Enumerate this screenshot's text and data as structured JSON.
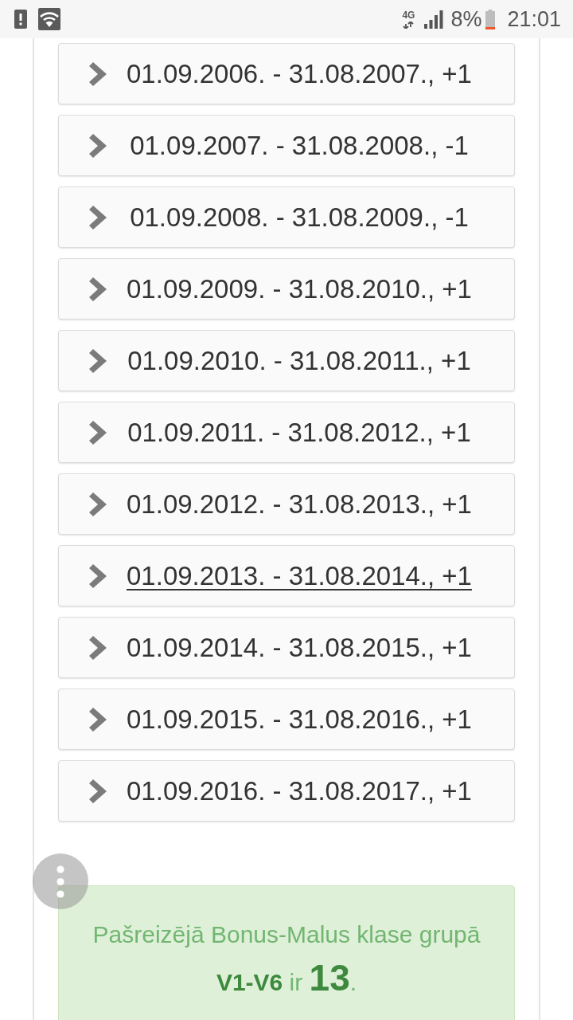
{
  "status_bar": {
    "network_type": "4G",
    "battery": "8%",
    "time": "21:01"
  },
  "periods": [
    {
      "label": "01.09.2006. - 31.08.2007., +1",
      "hovered": false
    },
    {
      "label": "01.09.2007. - 31.08.2008., -1",
      "hovered": false
    },
    {
      "label": "01.09.2008. - 31.08.2009., -1",
      "hovered": false
    },
    {
      "label": "01.09.2009. - 31.08.2010., +1",
      "hovered": false
    },
    {
      "label": "01.09.2010. - 31.08.2011., +1",
      "hovered": false
    },
    {
      "label": "01.09.2011. - 31.08.2012., +1",
      "hovered": false
    },
    {
      "label": "01.09.2012. - 31.08.2013., +1",
      "hovered": false
    },
    {
      "label": "01.09.2013. - 31.08.2014., +1",
      "hovered": true
    },
    {
      "label": "01.09.2014. - 31.08.2015., +1",
      "hovered": false
    },
    {
      "label": "01.09.2015. - 31.08.2016., +1",
      "hovered": false
    },
    {
      "label": "01.09.2016. - 31.08.2017., +1",
      "hovered": false
    }
  ],
  "result": {
    "text": "Pašreizējā Bonus-Malus klase grupā **V1-V6** ir **13**."
  }
}
